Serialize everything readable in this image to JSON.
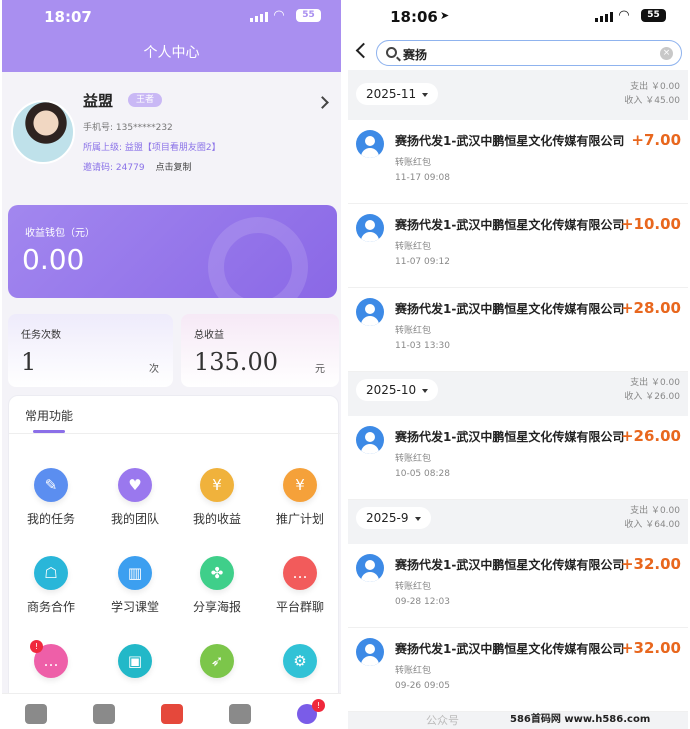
{
  "left": {
    "status": {
      "time": "18:07",
      "battery": "55"
    },
    "header_title": "个人中心",
    "profile": {
      "name": "益盟",
      "badge": "王者",
      "phone_label": "手机号:",
      "phone": "135*****232",
      "upline_label": "所属上级:",
      "upline": "益盟【项目看朋友圈2】",
      "invite_label": "邀请码:",
      "invite_code": "24779",
      "copy_label": "点击复制"
    },
    "wallet": {
      "label": "收益钱包（元）",
      "value": "0.00"
    },
    "stats": [
      {
        "label": "任务次数",
        "value": "1",
        "unit": "次"
      },
      {
        "label": "总收益",
        "value": "135.00",
        "unit": "元"
      }
    ],
    "functions_title": "常用功能",
    "functions": [
      {
        "label": "我的任务",
        "icon": "task-icon",
        "color": "#5b8ef0",
        "glyph": "✎"
      },
      {
        "label": "我的团队",
        "icon": "team-icon",
        "color": "#9a78ee",
        "glyph": "♥"
      },
      {
        "label": "我的收益",
        "icon": "income-icon",
        "color": "#f0b23c",
        "glyph": "¥"
      },
      {
        "label": "推广计划",
        "icon": "promotion-icon",
        "color": "#f5a13a",
        "glyph": "¥"
      },
      {
        "label": "商务合作",
        "icon": "business-icon",
        "color": "#29b6d9",
        "glyph": "☖"
      },
      {
        "label": "学习课堂",
        "icon": "classroom-icon",
        "color": "#3c9ff0",
        "glyph": "▥"
      },
      {
        "label": "分享海报",
        "icon": "poster-icon",
        "color": "#3fcf8a",
        "glyph": "✤"
      },
      {
        "label": "平台群聊",
        "icon": "group-chat-icon",
        "color": "#f25b5b",
        "glyph": "…"
      },
      {
        "label": "",
        "icon": "message-icon",
        "color": "#ee5fa8",
        "glyph": "…",
        "badge": "!"
      },
      {
        "label": "",
        "icon": "toolbox-icon",
        "color": "#22b8c8",
        "glyph": "▣"
      },
      {
        "label": "",
        "icon": "rocket-icon",
        "color": "#7cc64a",
        "glyph": "➶"
      },
      {
        "label": "",
        "icon": "settings-icon",
        "color": "#31c2d6",
        "glyph": "⚙"
      }
    ],
    "tabbar": [
      {
        "icon": "home-icon",
        "color": "#8a8a8a",
        "label": ""
      },
      {
        "icon": "crown-icon",
        "color": "#8a8a8a",
        "label": ""
      },
      {
        "icon": "red-packet-icon",
        "color": "#e5483b",
        "label": ""
      },
      {
        "icon": "profile-card-icon",
        "color": "#8a8a8a",
        "label": ""
      },
      {
        "icon": "user-icon",
        "color": "#7a5ce8",
        "label": "",
        "badge": "!"
      }
    ]
  },
  "right": {
    "status": {
      "time": "18:06",
      "battery": "55"
    },
    "search": {
      "value": "赛扬"
    },
    "groups": [
      {
        "month": "2025-11",
        "expense": "支出 ￥0.00",
        "income": "收入 ￥45.00",
        "items": [
          {
            "title": "赛扬代发1-武汉中鹏恒星文化传媒有限公司",
            "amount": "+7.00",
            "type": "转账红包",
            "time": "11-17 09:08"
          },
          {
            "title": "赛扬代发1-武汉中鹏恒星文化传媒有限公司",
            "amount": "+10.00",
            "type": "转账红包",
            "time": "11-07 09:12"
          },
          {
            "title": "赛扬代发1-武汉中鹏恒星文化传媒有限公司",
            "amount": "+28.00",
            "type": "转账红包",
            "time": "11-03 13:30"
          }
        ]
      },
      {
        "month": "2025-10",
        "expense": "支出 ￥0.00",
        "income": "收入 ￥26.00",
        "items": [
          {
            "title": "赛扬代发1-武汉中鹏恒星文化传媒有限公司",
            "amount": "+26.00",
            "type": "转账红包",
            "time": "10-05 08:28"
          }
        ]
      },
      {
        "month": "2025-9",
        "expense": "支出 ￥0.00",
        "income": "收入 ￥64.00",
        "items": [
          {
            "title": "赛扬代发1-武汉中鹏恒星文化传媒有限公司",
            "amount": "+32.00",
            "type": "转账红包",
            "time": "09-28 12:03"
          },
          {
            "title": "赛扬代发1-武汉中鹏恒星文化传媒有限公司",
            "amount": "+32.00",
            "type": "转账红包",
            "time": "09-26 09:05"
          }
        ]
      }
    ]
  },
  "watermark": {
    "site": "586首码网 www.h586.com",
    "account": "公众号"
  }
}
